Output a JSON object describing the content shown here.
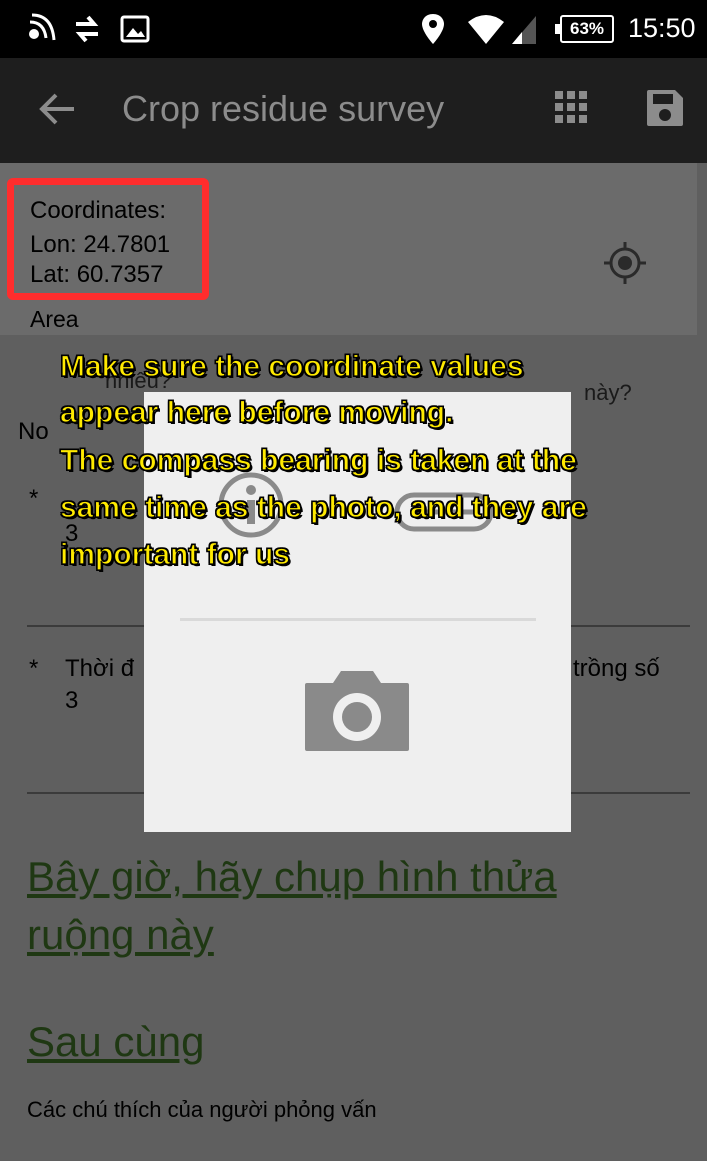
{
  "status_bar": {
    "battery": "63%",
    "time": "15:50",
    "icons": [
      "nfc-icon",
      "sync-icon",
      "image-icon",
      "location-icon",
      "wifi-icon",
      "signal-icon",
      "battery-icon"
    ]
  },
  "app_bar": {
    "title": "Crop residue survey",
    "actions": [
      "back-icon",
      "grid-icon",
      "save-icon"
    ]
  },
  "coordinates": {
    "label": "Coordinates:",
    "lon": "Lon: 24.7801",
    "lat": "Lat: 60.7357",
    "area": "Area"
  },
  "form": {
    "partial_1": "nhiêu?",
    "partial_2": "này?",
    "partial_no": "No",
    "star": "*",
    "partial_3": "3",
    "q3_left": "Thời đ",
    "q3_right": "trồng số",
    "q3_num": "3"
  },
  "sections": {
    "photo_link": "Bây giờ, hãy chụp hình thửa ruộng này",
    "final_link": "Sau cùng",
    "interviewer_notes": "Các chú thích của người phỏng vấn"
  },
  "annotation": {
    "line1": "Make sure the coordinate values",
    "line2": "appear here before moving.",
    "line3": "The compass bearing is taken at the",
    "line4": "same time as the photo, and they are",
    "line5": "important for us"
  },
  "colors": {
    "highlight_border": "#ff2d2d",
    "annotation_text": "#ffea00",
    "link_text": "#1f3813"
  }
}
